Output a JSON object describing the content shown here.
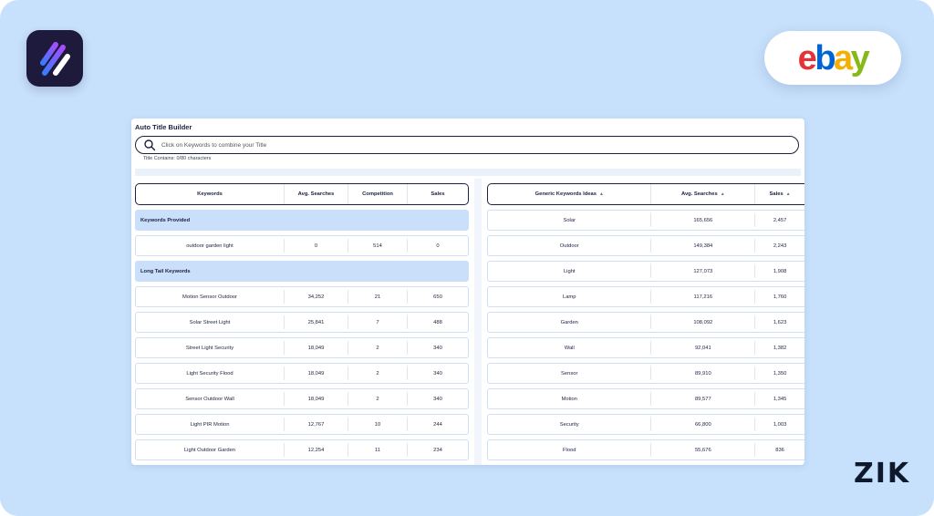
{
  "app": {
    "title": "Auto Title Builder"
  },
  "search": {
    "placeholder": "Click on Keywords to combine your Title"
  },
  "title_counter": "Title Contains: 0/80 characters",
  "brand": {
    "marketplace": "ebay",
    "logo_letters": [
      "e",
      "b",
      "a",
      "y"
    ],
    "company": "ZIK"
  },
  "colors": {
    "background": "#c7e0fb",
    "section": "#c9dffa",
    "ink": "#1b2140",
    "ebay_red": "#e53238",
    "ebay_blue": "#0064d2",
    "ebay_yellow": "#f5af02",
    "ebay_green": "#86b817"
  },
  "left_table": {
    "headers": [
      "Keywords",
      "Avg. Searches",
      "Competition",
      "Sales"
    ],
    "sections": {
      "provided": "Keywords Provided",
      "long_tail": "Long Tail Keywords"
    },
    "provided_rows": [
      [
        "outdoor garden light",
        "0",
        "514",
        "0"
      ]
    ],
    "long_tail_rows": [
      [
        "Motion Sensor Outdoor",
        "34,252",
        "21",
        "650"
      ],
      [
        "Solar Street Light",
        "25,841",
        "7",
        "488"
      ],
      [
        "Street Light Security",
        "18,049",
        "2",
        "340"
      ],
      [
        "Light Security Flood",
        "18,049",
        "2",
        "340"
      ],
      [
        "Sensor Outdoor Wall",
        "18,049",
        "2",
        "340"
      ],
      [
        "Light PIR Motion",
        "12,767",
        "10",
        "244"
      ],
      [
        "Light Outdoor Garden",
        "12,254",
        "11",
        "234"
      ]
    ]
  },
  "right_table": {
    "headers": [
      "Generic Keywords Ideas",
      "Avg. Searches",
      "Sales"
    ],
    "rows": [
      [
        "Solar",
        "165,656",
        "2,457"
      ],
      [
        "Outdoor",
        "149,384",
        "2,243"
      ],
      [
        "Light",
        "127,073",
        "1,908"
      ],
      [
        "Lamp",
        "117,216",
        "1,760"
      ],
      [
        "Garden",
        "108,092",
        "1,623"
      ],
      [
        "Wall",
        "92,041",
        "1,382"
      ],
      [
        "Sensor",
        "89,910",
        "1,350"
      ],
      [
        "Motion",
        "89,577",
        "1,345"
      ],
      [
        "Security",
        "66,800",
        "1,003"
      ],
      [
        "Flood",
        "55,676",
        "836"
      ]
    ]
  }
}
